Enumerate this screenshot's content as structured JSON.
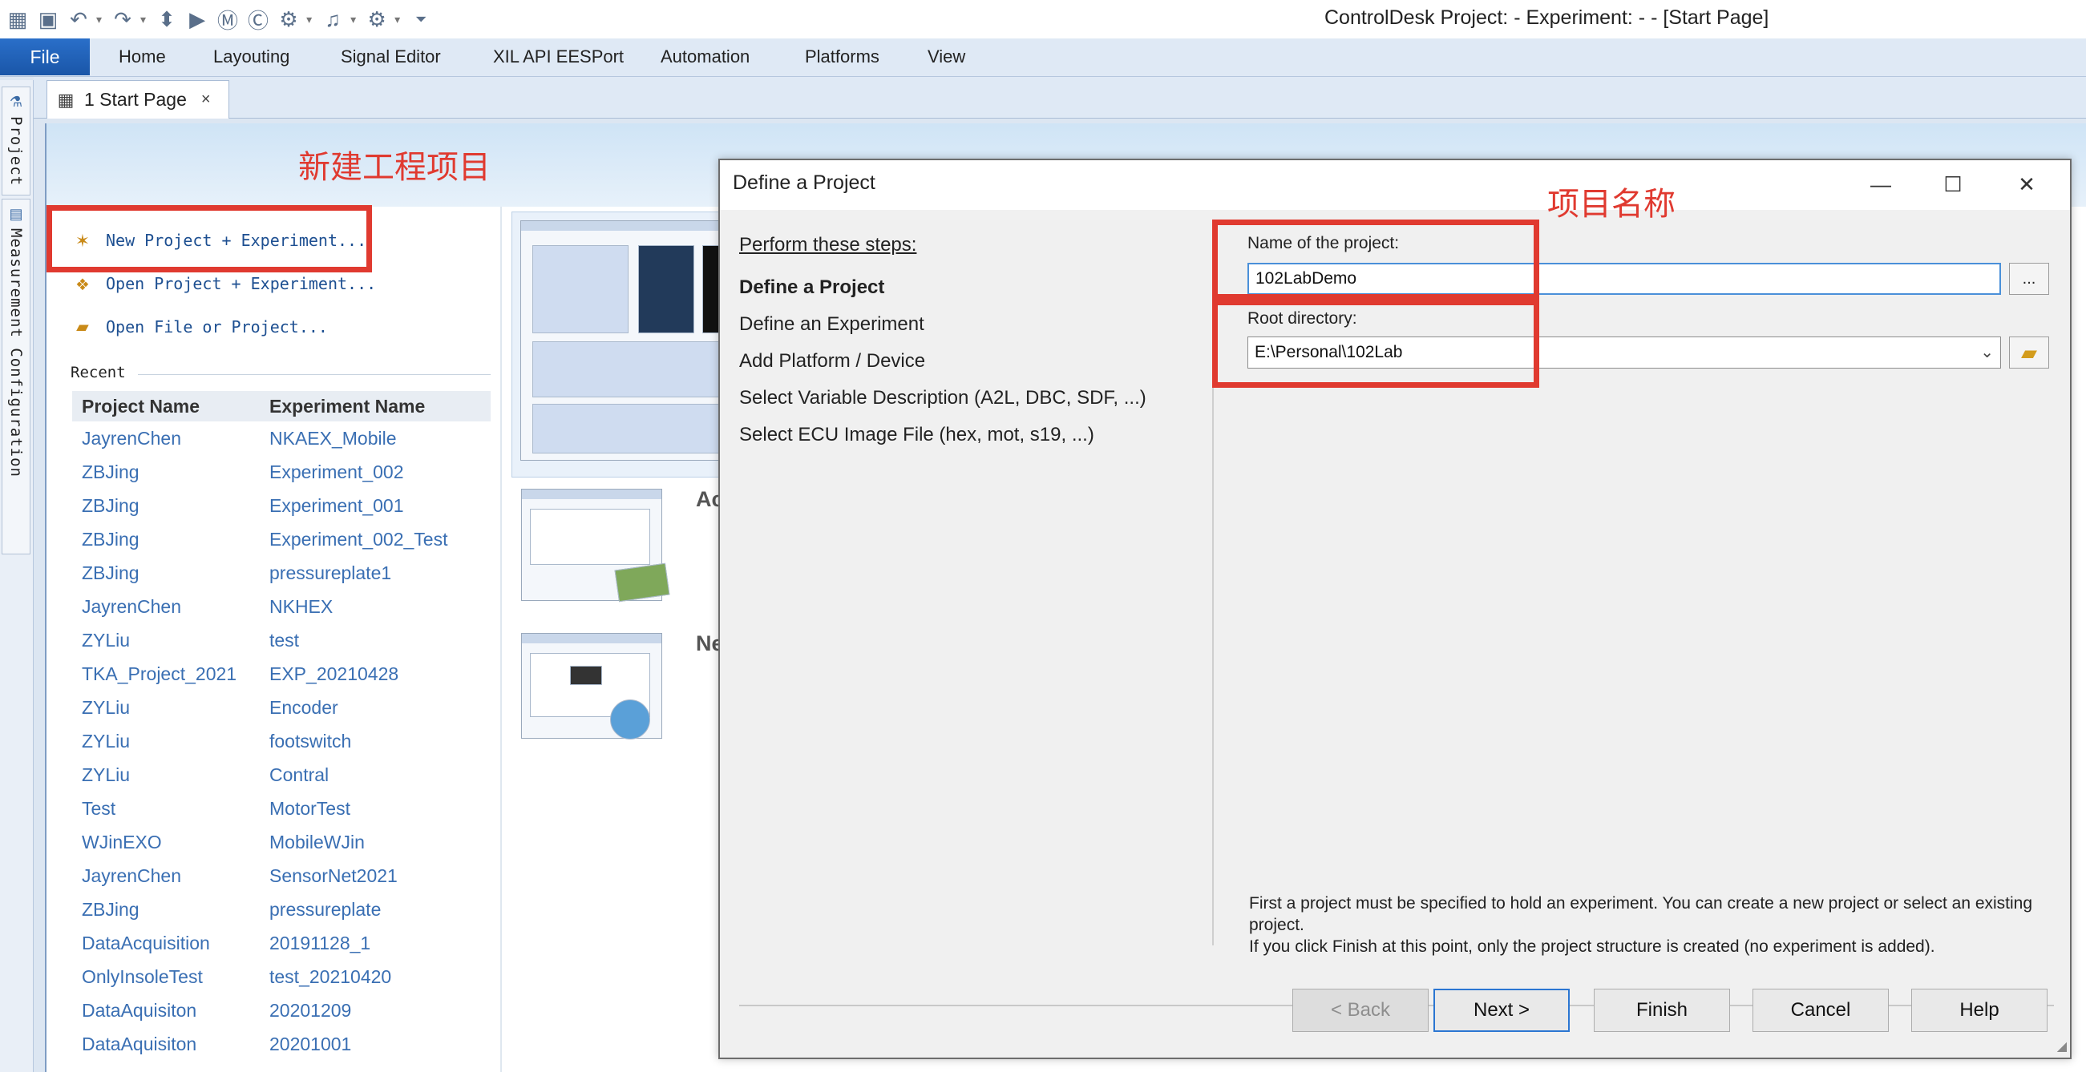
{
  "window": {
    "title": "ControlDesk  Project: -  Experiment: - - [Start Page]"
  },
  "quick_access": {
    "icons": [
      "app-icon",
      "save-icon",
      "undo-icon",
      "redo-icon",
      "move-icon",
      "play-icon",
      "m-icon",
      "c-icon",
      "tool1-icon",
      "tool2-icon",
      "tool3-icon",
      "customize-icon"
    ]
  },
  "ribbon": {
    "file": "File",
    "tabs": [
      "Home",
      "Layouting",
      "Signal Editor",
      "XIL API EESPort",
      "Automation",
      "Platforms",
      "View"
    ]
  },
  "side_panels": {
    "project": "Project",
    "measurement": "Measurement Configuration"
  },
  "doc_tab": {
    "label": "1 Start Page",
    "close": "×"
  },
  "start_page": {
    "links": {
      "new": "New Project + Experiment...",
      "open": "Open Project + Experiment...",
      "open_file": "Open File or Project..."
    },
    "recent_label": "Recent",
    "columns": [
      "Project Name",
      "Experiment Name"
    ],
    "recent": [
      [
        "JayrenChen",
        "NKAEX_Mobile"
      ],
      [
        "ZBJing",
        "Experiment_002"
      ],
      [
        "ZBJing",
        "Experiment_001"
      ],
      [
        "ZBJing",
        "Experiment_002_Test"
      ],
      [
        "ZBJing",
        "pressureplate1"
      ],
      [
        "JayrenChen",
        "NKHEX"
      ],
      [
        "ZYLiu",
        "test"
      ],
      [
        "TKA_Project_2021",
        "EXP_20210428"
      ],
      [
        "ZYLiu",
        "Encoder"
      ],
      [
        "ZYLiu",
        "footswitch"
      ],
      [
        "ZYLiu",
        "Contral"
      ],
      [
        "Test",
        "MotorTest"
      ],
      [
        "WJinEXO",
        "MobileWJin"
      ],
      [
        "JayrenChen",
        "SensorNet2021"
      ],
      [
        "ZBJing",
        "pressureplate"
      ],
      [
        "DataAcquisition",
        "20191128_1"
      ],
      [
        "OnlyInsoleTest",
        "test_20210420"
      ],
      [
        "DataAquisiton",
        "20201209"
      ],
      [
        "DataAquisiton",
        "20201001"
      ]
    ],
    "thumb_headings": [
      "Ac",
      "Ne"
    ]
  },
  "annotations": {
    "new_project": "新建工程项目",
    "project_name": "项目名称"
  },
  "dialog": {
    "title": "Define a Project",
    "controls": {
      "minimize": "—",
      "maximize": "☐",
      "close": "✕"
    },
    "steps_heading": "Perform these steps:",
    "steps": [
      "Define a Project",
      "Define an Experiment",
      "Add Platform / Device",
      "Select Variable Description (A2L, DBC, SDF, ...)",
      "Select ECU Image File (hex, mot, s19, ...)"
    ],
    "name_label": "Name of the project:",
    "name_value": "102LabDemo",
    "browse_label": "...",
    "root_label": "Root directory:",
    "root_value": "E:\\Personal\\102Lab",
    "hint_lines": [
      "First a project must be specified to hold an experiment. You can create a new project or select an existing project.",
      "If you click Finish at this point, only the project structure is created (no experiment is added)."
    ],
    "buttons": {
      "back": "< Back",
      "next": "Next >",
      "finish": "Finish",
      "cancel": "Cancel",
      "help": "Help"
    }
  }
}
